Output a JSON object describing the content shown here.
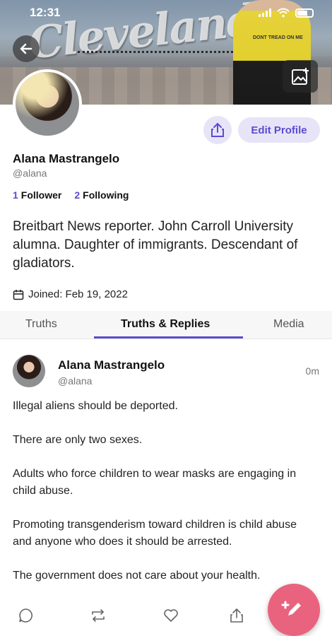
{
  "status_bar": {
    "time": "12:31"
  },
  "banner": {
    "sign_text": "Cleveland",
    "shirt_text": "DONT TREAD ON ME"
  },
  "profile": {
    "name": "Alana Mastrangelo",
    "handle": "@alana",
    "followers_count": "1",
    "followers_label": "Follower",
    "following_count": "2",
    "following_label": "Following",
    "bio": "Breitbart News reporter. John Carroll University alumna. Daughter of immigrants. Descendant of gladiators.",
    "joined": "Joined: Feb 19, 2022",
    "edit_label": "Edit Profile"
  },
  "tabs": [
    {
      "label": "Truths",
      "active": false
    },
    {
      "label": "Truths & Replies",
      "active": true
    },
    {
      "label": "Media",
      "active": false
    }
  ],
  "post": {
    "name": "Alana Mastrangelo",
    "handle": "@alana",
    "time": "0m",
    "paragraphs": [
      "Illegal aliens should be deported.",
      "There are only two sexes.",
      "Adults who force children to wear masks are engaging in child abuse.",
      "Promoting transgenderism toward children is child abuse and anyone who does it should be arrested.",
      "The government does not care about your health."
    ]
  },
  "icons": {
    "back": "arrow-left-icon",
    "banner_edit": "image-add-icon",
    "share": "share-icon",
    "calendar": "calendar-icon",
    "reply": "comment-icon",
    "retruth": "repost-icon",
    "like": "heart-icon",
    "post_share": "share-icon",
    "compose": "compose-icon"
  },
  "colors": {
    "accent": "#5a4ccf",
    "accent_light": "#e7e4f8",
    "fab": "#e9637f"
  }
}
